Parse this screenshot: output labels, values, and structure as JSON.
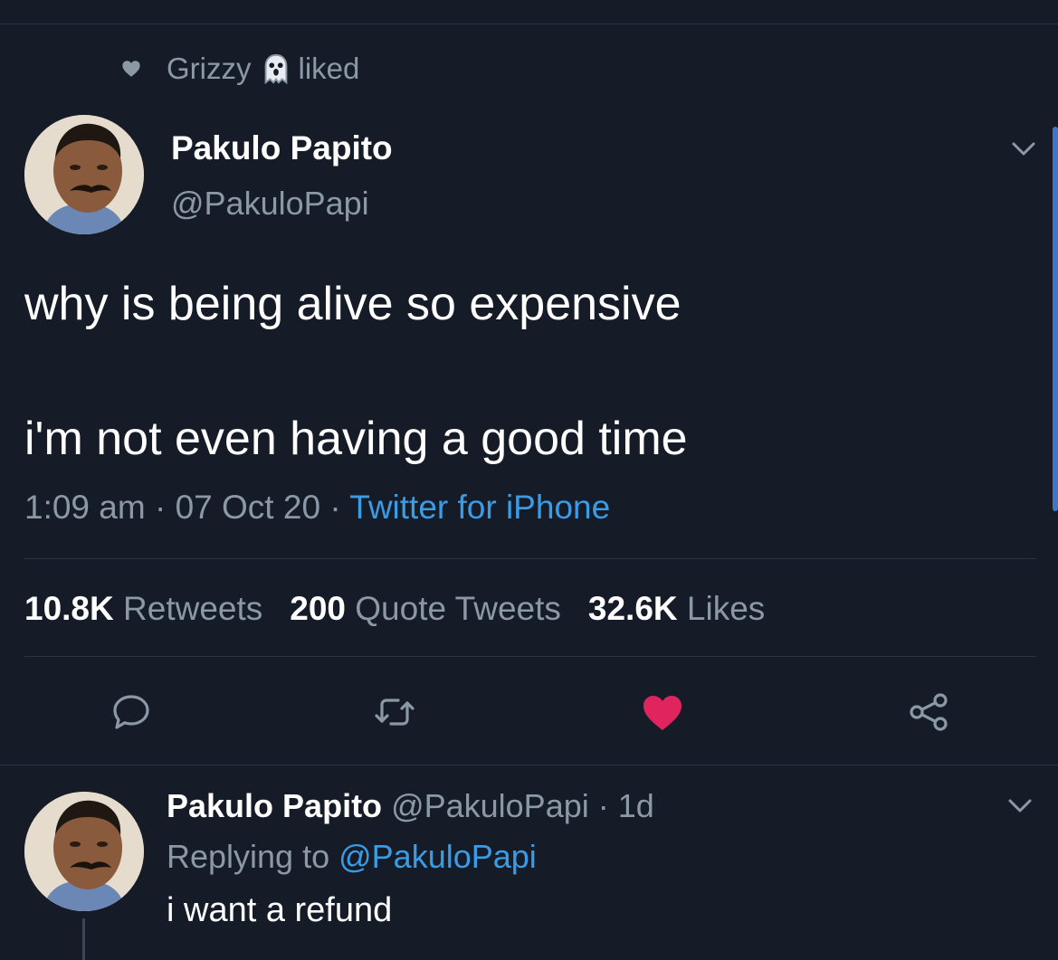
{
  "social_context": {
    "user": "Grizzy",
    "action": "liked"
  },
  "tweet": {
    "display_name": "Pakulo Papito",
    "handle": "@PakuloPapi",
    "text_line1": "why is being alive so expensive",
    "text_line2": "i'm not even having a good time",
    "time": "1:09 am",
    "date": "07 Oct 20",
    "source": "Twitter for iPhone",
    "sep": "·"
  },
  "stats": {
    "retweets_count": "10.8K",
    "retweets_label": "Retweets",
    "quotes_count": "200",
    "quotes_label": "Quote Tweets",
    "likes_count": "32.6K",
    "likes_label": "Likes"
  },
  "actions": {
    "icons": [
      "reply-icon",
      "retweet-icon",
      "like-icon",
      "share-icon"
    ],
    "liked_color": "#e0245e"
  },
  "reply": {
    "display_name": "Pakulo Papito",
    "handle": "@PakuloPapi",
    "sep": "·",
    "age": "1d",
    "replying_label": "Replying to",
    "replying_mention": "@PakuloPapi",
    "text": "i want a refund"
  },
  "colors": {
    "background": "#161c27",
    "accent": "#3a9be6",
    "muted": "#8b98a5"
  }
}
